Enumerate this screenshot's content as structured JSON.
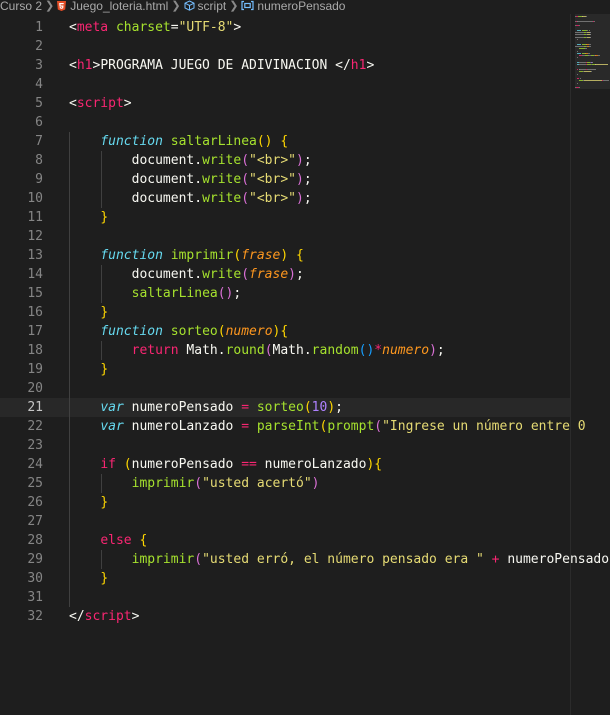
{
  "breadcrumb": {
    "items": [
      "Curso 2",
      "Juego_loteria.html",
      "script",
      "numeroPensado"
    ]
  },
  "editor": {
    "current_line": 21,
    "line_numbers": [
      "1",
      "2",
      "3",
      "4",
      "5",
      "6",
      "7",
      "8",
      "9",
      "10",
      "11",
      "12",
      "13",
      "14",
      "15",
      "16",
      "17",
      "18",
      "19",
      "20",
      "21",
      "22",
      "23",
      "24",
      "25",
      "26",
      "27",
      "28",
      "29",
      "30",
      "31",
      "32"
    ],
    "lines": [
      [
        [
          "pun",
          "<"
        ],
        [
          "tag",
          "meta"
        ],
        [
          "plain",
          " "
        ],
        [
          "attr",
          "charset"
        ],
        [
          "pun",
          "="
        ],
        [
          "str",
          "\"UTF-8\""
        ],
        [
          "pun",
          ">"
        ]
      ],
      [],
      [
        [
          "pun",
          "<"
        ],
        [
          "tag",
          "h1"
        ],
        [
          "pun",
          ">"
        ],
        [
          "plain",
          "PROGRAMA JUEGO DE ADIVINACION "
        ],
        [
          "pun",
          "</"
        ],
        [
          "tag",
          "h1"
        ],
        [
          "pun",
          ">"
        ]
      ],
      [],
      [
        [
          "pun",
          "<"
        ],
        [
          "tag",
          "script"
        ],
        [
          "pun",
          ">"
        ]
      ],
      [],
      [
        [
          "plain",
          "    "
        ],
        [
          "kw-fn",
          "function"
        ],
        [
          "plain",
          " "
        ],
        [
          "fn",
          "saltarLinea"
        ],
        [
          "bracket-y",
          "()"
        ],
        [
          "plain",
          " "
        ],
        [
          "bracket-y",
          "{"
        ]
      ],
      [
        [
          "plain",
          "        document."
        ],
        [
          "fn",
          "write"
        ],
        [
          "bracket-p",
          "("
        ],
        [
          "str",
          "\"<br>\""
        ],
        [
          "bracket-p",
          ")"
        ],
        [
          "plain",
          ";"
        ]
      ],
      [
        [
          "plain",
          "        document."
        ],
        [
          "fn",
          "write"
        ],
        [
          "bracket-p",
          "("
        ],
        [
          "str",
          "\"<br>\""
        ],
        [
          "bracket-p",
          ")"
        ],
        [
          "plain",
          ";"
        ]
      ],
      [
        [
          "plain",
          "        document."
        ],
        [
          "fn",
          "write"
        ],
        [
          "bracket-p",
          "("
        ],
        [
          "str",
          "\"<br>\""
        ],
        [
          "bracket-p",
          ")"
        ],
        [
          "plain",
          ";"
        ]
      ],
      [
        [
          "plain",
          "    "
        ],
        [
          "bracket-y",
          "}"
        ]
      ],
      [],
      [
        [
          "plain",
          "    "
        ],
        [
          "kw-fn",
          "function"
        ],
        [
          "plain",
          " "
        ],
        [
          "fn",
          "imprimir"
        ],
        [
          "bracket-y",
          "("
        ],
        [
          "param",
          "frase"
        ],
        [
          "bracket-y",
          ")"
        ],
        [
          "plain",
          " "
        ],
        [
          "bracket-y",
          "{"
        ]
      ],
      [
        [
          "plain",
          "        document."
        ],
        [
          "fn",
          "write"
        ],
        [
          "bracket-p",
          "("
        ],
        [
          "param",
          "frase"
        ],
        [
          "bracket-p",
          ")"
        ],
        [
          "plain",
          ";"
        ]
      ],
      [
        [
          "plain",
          "        "
        ],
        [
          "fn",
          "saltarLinea"
        ],
        [
          "bracket-p",
          "()"
        ],
        [
          "plain",
          ";"
        ]
      ],
      [
        [
          "plain",
          "    "
        ],
        [
          "bracket-y",
          "}"
        ]
      ],
      [
        [
          "plain",
          "    "
        ],
        [
          "kw-fn",
          "function"
        ],
        [
          "plain",
          " "
        ],
        [
          "fn",
          "sorteo"
        ],
        [
          "bracket-y",
          "("
        ],
        [
          "param",
          "numero"
        ],
        [
          "bracket-y",
          ")"
        ],
        [
          "bracket-y",
          "{"
        ]
      ],
      [
        [
          "plain",
          "        "
        ],
        [
          "kw",
          "return"
        ],
        [
          "plain",
          " Math."
        ],
        [
          "fn",
          "round"
        ],
        [
          "bracket-p",
          "("
        ],
        [
          "plain",
          "Math."
        ],
        [
          "fn",
          "random"
        ],
        [
          "bracket-b",
          "()"
        ],
        [
          "op",
          "*"
        ],
        [
          "param",
          "numero"
        ],
        [
          "bracket-p",
          ")"
        ],
        [
          "plain",
          ";"
        ]
      ],
      [
        [
          "plain",
          "    "
        ],
        [
          "bracket-y",
          "}"
        ]
      ],
      [],
      [
        [
          "plain",
          "    "
        ],
        [
          "kw-fn",
          "var"
        ],
        [
          "plain",
          " numeroPensado "
        ],
        [
          "op",
          "="
        ],
        [
          "plain",
          " "
        ],
        [
          "fn",
          "sorteo"
        ],
        [
          "bracket-y",
          "("
        ],
        [
          "num",
          "10"
        ],
        [
          "bracket-y",
          ")"
        ],
        [
          "plain",
          ";"
        ]
      ],
      [
        [
          "plain",
          "    "
        ],
        [
          "kw-fn",
          "var"
        ],
        [
          "plain",
          " numeroLanzado "
        ],
        [
          "op",
          "="
        ],
        [
          "plain",
          " "
        ],
        [
          "fn",
          "parseInt"
        ],
        [
          "bracket-y",
          "("
        ],
        [
          "fn",
          "prompt"
        ],
        [
          "bracket-p",
          "("
        ],
        [
          "str",
          "\"Ingrese un número entre 0"
        ]
      ],
      [],
      [
        [
          "plain",
          "    "
        ],
        [
          "kw",
          "if"
        ],
        [
          "plain",
          " "
        ],
        [
          "bracket-y",
          "("
        ],
        [
          "plain",
          "numeroPensado "
        ],
        [
          "op",
          "=="
        ],
        [
          "plain",
          " numeroLanzado"
        ],
        [
          "bracket-y",
          ")"
        ],
        [
          "bracket-y",
          "{"
        ]
      ],
      [
        [
          "plain",
          "        "
        ],
        [
          "fn",
          "imprimir"
        ],
        [
          "bracket-p",
          "("
        ],
        [
          "str",
          "\"usted acertó\""
        ],
        [
          "bracket-p",
          ")"
        ]
      ],
      [
        [
          "plain",
          "    "
        ],
        [
          "bracket-y",
          "}"
        ]
      ],
      [],
      [
        [
          "plain",
          "    "
        ],
        [
          "kw",
          "else"
        ],
        [
          "plain",
          " "
        ],
        [
          "bracket-y",
          "{"
        ]
      ],
      [
        [
          "plain",
          "        "
        ],
        [
          "fn",
          "imprimir"
        ],
        [
          "bracket-p",
          "("
        ],
        [
          "str",
          "\"usted erró, el número pensado era \""
        ],
        [
          "plain",
          " "
        ],
        [
          "op",
          "+"
        ],
        [
          "plain",
          " numeroPensado"
        ]
      ],
      [
        [
          "plain",
          "    "
        ],
        [
          "bracket-y",
          "}"
        ]
      ],
      [],
      [
        [
          "pun",
          "</"
        ],
        [
          "tag",
          "script"
        ],
        [
          "pun",
          ">"
        ]
      ]
    ]
  },
  "colors": {
    "background": "#1e1e1e",
    "line_number": "#858585",
    "current_line_bg": "#282828",
    "tag": "#f92672",
    "attribute": "#a6e22e",
    "string": "#e6db74",
    "keyword_italic": "#66d9ef",
    "parameter": "#fd971f",
    "number": "#ae81ff"
  },
  "icons": {
    "file": "html5-icon",
    "symbol_script": "cube-icon",
    "symbol_variable": "variable-icon",
    "separator": "chevron-right-icon"
  }
}
